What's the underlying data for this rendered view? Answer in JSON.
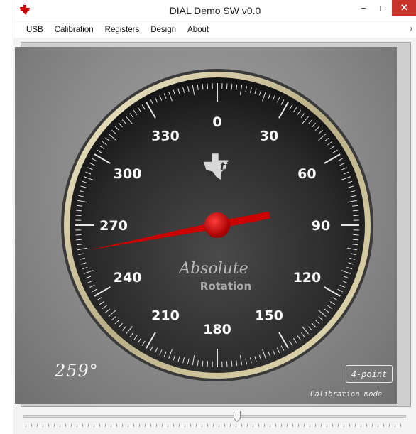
{
  "window": {
    "title": "DIAL Demo SW v0.0",
    "controls": {
      "minimize": "−",
      "maximize": "□",
      "close": "✕"
    }
  },
  "menu": {
    "items": [
      "USB",
      "Calibration",
      "Registers",
      "Design",
      "About"
    ],
    "overflow": "›"
  },
  "dial": {
    "labels": [
      "0",
      "30",
      "60",
      "90",
      "120",
      "150",
      "180",
      "210",
      "240",
      "270",
      "300",
      "330"
    ],
    "brand_text": "Absolute",
    "brand_subtext": "Rotation",
    "needle_angle_deg": 259,
    "needle_color": "#cc0000"
  },
  "readout": {
    "angle_text": "259°"
  },
  "calibration": {
    "badge": "4-point",
    "mode_text": "Calibration mode"
  },
  "slider": {
    "value_fraction": 0.56
  },
  "colors": {
    "logo_red": "#cc0000",
    "close_red": "#c7332a",
    "bezel": "#d9d1a8"
  }
}
